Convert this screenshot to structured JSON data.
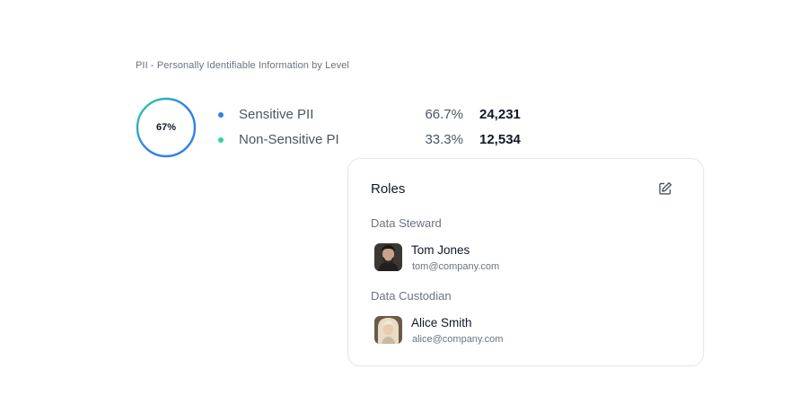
{
  "pii": {
    "title": "PII - Personally Identifiable Information by Level",
    "donut_label": "67%",
    "donut_fraction": 0.667,
    "colors": {
      "sensitive": "#2f80ed",
      "non_sensitive": "#34d399",
      "track": "#e5e7eb"
    },
    "items": [
      {
        "name": "Sensitive PII",
        "percent": "66.7%",
        "count": "24,231"
      },
      {
        "name": "Non-Sensitive PI",
        "percent": "33.3%",
        "count": "12,534"
      }
    ]
  },
  "roles": {
    "title": "Roles",
    "edit_icon": "pencil-square-icon",
    "groups": [
      {
        "label": "Data Steward",
        "person": {
          "name": "Tom Jones",
          "email": "tom@company.com"
        }
      },
      {
        "label": "Data Custodian",
        "person": {
          "name": "Alice Smith",
          "email": "alice@company.com"
        }
      }
    ]
  }
}
